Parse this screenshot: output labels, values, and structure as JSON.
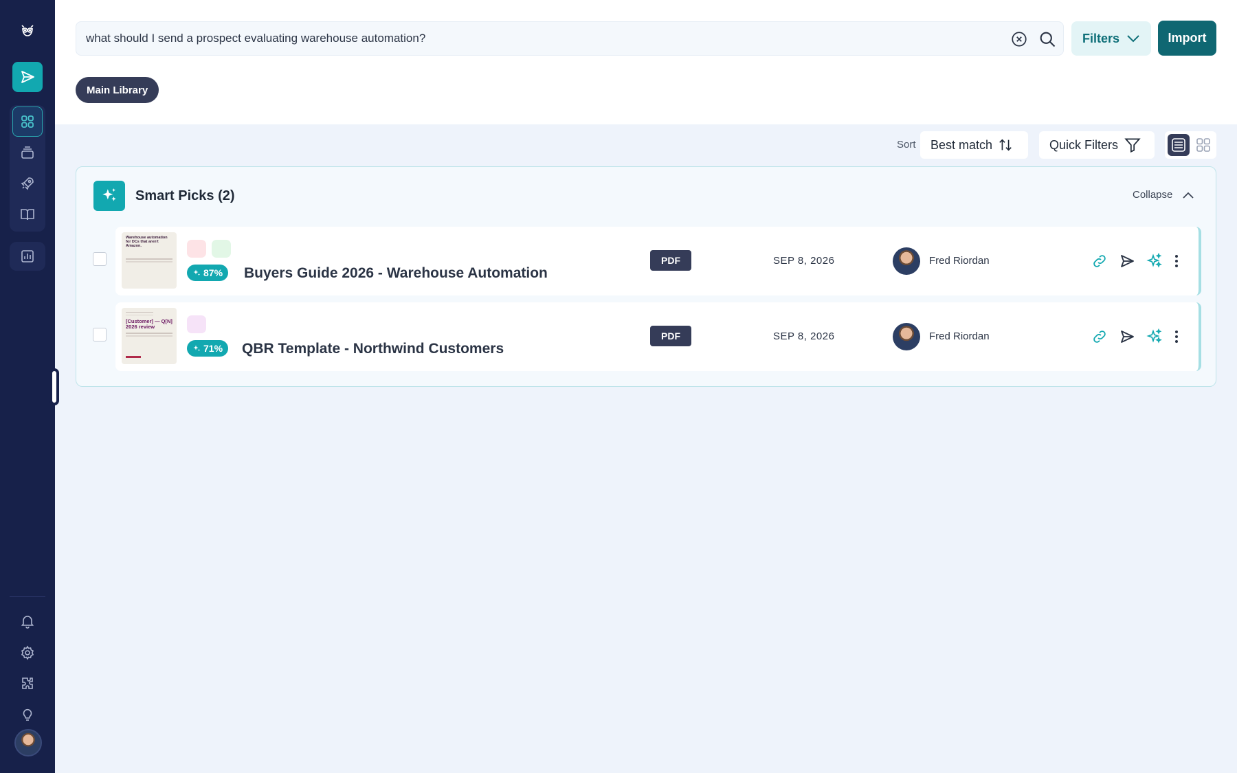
{
  "search": {
    "query": "what should I send a prospect evaluating warehouse automation?",
    "filters_label": "Filters",
    "import_label": "Import"
  },
  "library_chip": "Main Library",
  "toolbar": {
    "sort_label": "Sort",
    "sort_value": "Best match",
    "quick_filters_label": "Quick Filters"
  },
  "smart_picks": {
    "title": "Smart Picks (2)",
    "collapse_label": "Collapse",
    "items": [
      {
        "title": "Buyers Guide 2026 - Warehouse Automation",
        "score": "87%",
        "type": "PDF",
        "date": "SEP 8, 2026",
        "owner": "Fred Riordan",
        "thumb_title": "Warehouse automation for DCs that aren't Amazon.",
        "tag_colors": [
          "#fde3e6",
          "#e2f7e6"
        ]
      },
      {
        "title": "QBR Template - Northwind Customers",
        "score": "71%",
        "type": "PDF",
        "date": "SEP 8, 2026",
        "owner": "Fred Riordan",
        "thumb_title": "[Customer] — Q[N] 2026 review",
        "tag_colors": [
          "#f6e3f8"
        ]
      }
    ]
  },
  "colors": {
    "sidebar": "#17214a",
    "accent": "#12a8b0",
    "primary_button": "#0f6772",
    "chip": "#353c58"
  }
}
